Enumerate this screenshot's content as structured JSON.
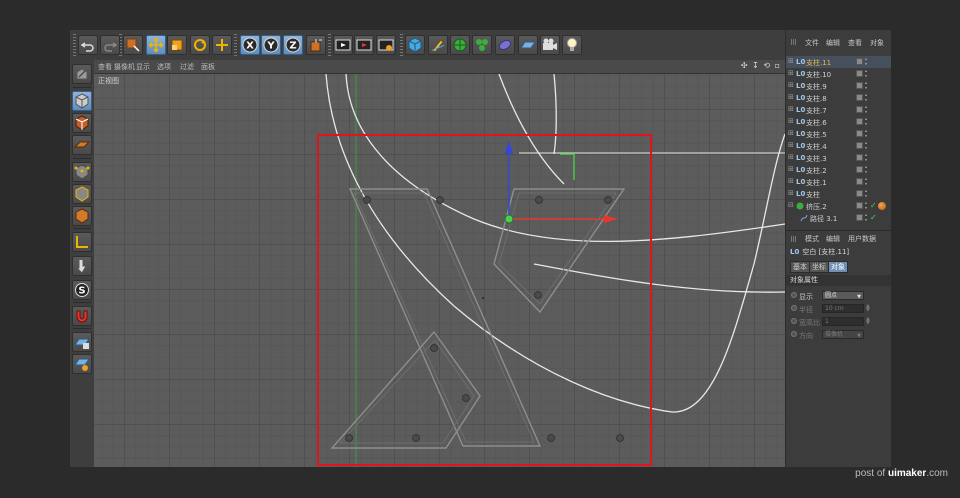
{
  "colors": {
    "selection_frame": "#e1141b",
    "axis_x": "#e8362b",
    "axis_y": "#4e9a3a",
    "axis_z": "#3447d8",
    "spline": "#e8e8e8",
    "active_tool": "#6f9ccc",
    "selected_object": "#e6b84a"
  },
  "toolbar": {
    "buttons": [
      {
        "icon": "undo-icon",
        "name": "undo-button",
        "active": false
      },
      {
        "icon": "redo-icon",
        "name": "redo-button",
        "active": false
      },
      {
        "icon": "live-selection-icon",
        "name": "live-selection-button",
        "active": false
      },
      {
        "icon": "move-icon",
        "name": "move-tool-button",
        "active": true
      },
      {
        "icon": "scale-icon",
        "name": "scale-tool-button",
        "active": false
      },
      {
        "icon": "rotate-icon",
        "name": "rotate-tool-button",
        "active": false
      },
      {
        "icon": "cross-icon",
        "name": "recent-tool-button",
        "active": false
      },
      {
        "icon": "x-axis-icon",
        "name": "x-axis-lock-button",
        "active": true
      },
      {
        "icon": "y-axis-icon",
        "name": "y-axis-lock-button",
        "active": true
      },
      {
        "icon": "z-axis-icon",
        "name": "z-axis-lock-button",
        "active": true
      },
      {
        "icon": "coordinate-system-icon",
        "name": "coordinate-system-button",
        "active": false
      },
      {
        "icon": "render-view-icon",
        "name": "render-view-button",
        "active": false
      },
      {
        "icon": "render-picture-viewer-icon",
        "name": "render-to-picture-viewer-button",
        "active": false
      },
      {
        "icon": "render-settings-icon",
        "name": "render-settings-button",
        "active": false
      },
      {
        "icon": "cube-icon",
        "name": "add-cube-button",
        "active": false
      },
      {
        "icon": "pen-icon",
        "name": "pen-spline-button",
        "active": false
      },
      {
        "icon": "subdivision-icon",
        "name": "subdivision-surface-button",
        "active": false
      },
      {
        "icon": "cloner-icon",
        "name": "cloner-button",
        "active": false
      },
      {
        "icon": "deformer-icon",
        "name": "deformer-button",
        "active": false
      },
      {
        "icon": "floor-icon",
        "name": "floor-button",
        "active": false
      },
      {
        "icon": "camera-icon",
        "name": "camera-button",
        "active": false
      },
      {
        "icon": "light-icon",
        "name": "light-button",
        "active": false
      }
    ]
  },
  "left_tools": [
    {
      "icon": "make-editable-icon",
      "name": "make-editable-button",
      "active": false
    },
    {
      "icon": "model-mode-icon",
      "name": "model-mode-button",
      "active": true
    },
    {
      "icon": "texture-mode-icon",
      "name": "texture-mode-button",
      "active": false
    },
    {
      "icon": "workplane-icon",
      "name": "workplane-button",
      "active": false
    },
    {
      "icon": "points-mode-icon",
      "name": "points-mode-button",
      "active": false
    },
    {
      "icon": "edges-mode-icon",
      "name": "edges-mode-button",
      "active": false
    },
    {
      "icon": "polygons-mode-icon",
      "name": "polygons-mode-button",
      "active": false
    },
    {
      "icon": "axis-mode-icon",
      "name": "axis-mode-button",
      "active": false
    },
    {
      "icon": "tweak-mode-icon",
      "name": "tweak-mode-button",
      "active": false
    },
    {
      "icon": "snap-icon",
      "name": "snap-button",
      "active": false
    },
    {
      "icon": "magnet-icon",
      "name": "magnet-button",
      "active": false
    },
    {
      "icon": "grid-lock-icon",
      "name": "workplane-lock-button",
      "active": false
    },
    {
      "icon": "grid-planar-icon",
      "name": "planar-workplane-button",
      "active": false
    }
  ],
  "viewport": {
    "menu": [
      "查看",
      "摄像机",
      "显示",
      "选项",
      "过滤",
      "面板"
    ],
    "title": "正视图",
    "nav_icons": "✣ ↧ ⟲ ▫"
  },
  "object_manager": {
    "menu": [
      "文件",
      "编辑",
      "查看",
      "对象"
    ],
    "rows": [
      {
        "name": "支柱.11",
        "selected": true,
        "type": "null",
        "expander": "⊞"
      },
      {
        "name": "支柱.10",
        "selected": false,
        "type": "null",
        "expander": "⊞"
      },
      {
        "name": "支柱.9",
        "selected": false,
        "type": "null",
        "expander": "⊞"
      },
      {
        "name": "支柱.8",
        "selected": false,
        "type": "null",
        "expander": "⊞"
      },
      {
        "name": "支柱.7",
        "selected": false,
        "type": "null",
        "expander": "⊞"
      },
      {
        "name": "支柱.6",
        "selected": false,
        "type": "null",
        "expander": "⊞"
      },
      {
        "name": "支柱.5",
        "selected": false,
        "type": "null",
        "expander": "⊞"
      },
      {
        "name": "支柱.4",
        "selected": false,
        "type": "null",
        "expander": "⊞"
      },
      {
        "name": "支柱.3",
        "selected": false,
        "type": "null",
        "expander": "⊞"
      },
      {
        "name": "支柱.2",
        "selected": false,
        "type": "null",
        "expander": "⊞"
      },
      {
        "name": "支柱.1",
        "selected": false,
        "type": "null",
        "expander": "⊞"
      },
      {
        "name": "支柱",
        "selected": false,
        "type": "null",
        "expander": "⊞"
      },
      {
        "name": "挤压.2",
        "selected": false,
        "type": "extrude",
        "expander": "⊟",
        "check": "✓",
        "material": true
      },
      {
        "name": "路径 3.1",
        "selected": false,
        "type": "spline",
        "expander": "",
        "check": "✓"
      }
    ]
  },
  "attributes": {
    "menu": [
      "模式",
      "编辑",
      "用户数据"
    ],
    "title": "空白 [支柱.11]",
    "title_icon": "L0",
    "tabs": [
      "基本",
      "坐标",
      "对象"
    ],
    "active_tab": 2,
    "section": "对象属性",
    "props": [
      {
        "label": "显示",
        "value": "圆点",
        "kind": "select",
        "dim": false
      },
      {
        "label": "半径",
        "value": "10 cm",
        "kind": "number",
        "dim": true
      },
      {
        "label": "宽高比",
        "value": "1",
        "kind": "number",
        "dim": true
      },
      {
        "label": "方向",
        "value": "摄像机",
        "kind": "select",
        "dim": true
      }
    ]
  },
  "watermark": {
    "prefix": "post of ",
    "site": "uimaker",
    "suffix": ".com"
  }
}
